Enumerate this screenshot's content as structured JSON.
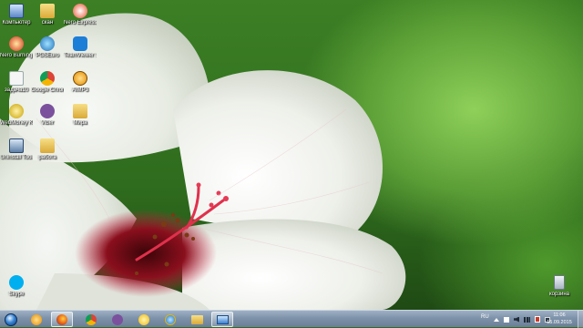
{
  "desktop_icons": [
    {
      "label": "Компьютер",
      "icon": "computer-icon"
    },
    {
      "label": "скан",
      "icon": "folder-icon"
    },
    {
      "label": "Nero Express",
      "icon": "nero-express-icon"
    },
    {
      "label": "Nero Burning ROM",
      "icon": "nero-burning-rom-icon"
    },
    {
      "label": "PGSEuro",
      "icon": "pgseuro-icon"
    },
    {
      "label": "TeamViewer 10",
      "icon": "teamviewer-icon"
    },
    {
      "label": "задача10",
      "icon": "text-file-icon"
    },
    {
      "label": "Google Chrome",
      "icon": "chrome-icon"
    },
    {
      "label": "AIMP3",
      "icon": "aimp-icon"
    },
    {
      "label": "WebMoney Keeper Wi...",
      "icon": "webmoney-icon"
    },
    {
      "label": "Viber",
      "icon": "viber-icon"
    },
    {
      "label": "Мира",
      "icon": "folder-icon"
    },
    {
      "label": "Uninstall Tool",
      "icon": "uninstall-tool-icon"
    },
    {
      "label": "работа",
      "icon": "folder-icon"
    },
    {
      "label": "Skype",
      "icon": "skype-icon"
    },
    {
      "label": "корзина",
      "icon": "recycle-bin-icon"
    }
  ],
  "taskbar": {
    "items": [
      {
        "icon": "start-orb-icon",
        "active": false
      },
      {
        "icon": "aimp-icon",
        "active": false
      },
      {
        "icon": "firefox-icon",
        "active": true
      },
      {
        "icon": "chrome-icon",
        "active": false
      },
      {
        "icon": "viber-icon",
        "active": false
      },
      {
        "icon": "messenger-icon",
        "active": false
      },
      {
        "icon": "internet-explorer-icon",
        "active": false
      },
      {
        "icon": "explorer-icon",
        "active": false
      },
      {
        "icon": "remote-desktop-icon",
        "active": true
      }
    ],
    "tray": {
      "language": "RU",
      "time": "11:06",
      "date": "15.09.2015",
      "icons": [
        "show-hidden-icon",
        "flag-icon",
        "speaker-icon",
        "network-icon",
        "battery-icon",
        "usb-icon"
      ]
    }
  },
  "colors": {
    "taskbar": "#7e93aa",
    "background": "#3c7f24"
  }
}
